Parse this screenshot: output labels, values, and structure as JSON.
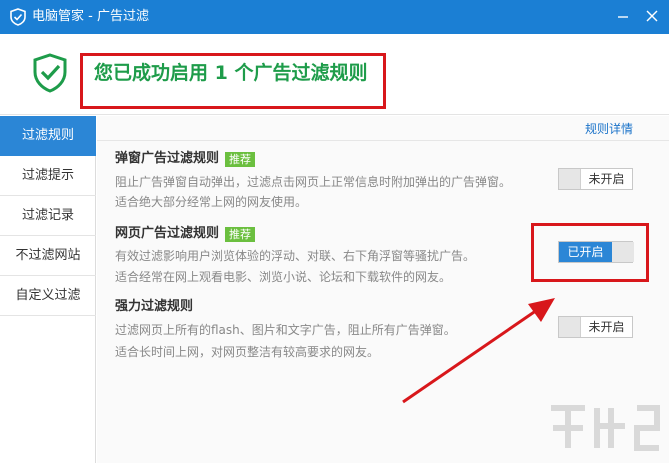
{
  "window": {
    "title": "电脑管家 - 广告过滤"
  },
  "banner": {
    "message": "您已成功启用 1 个广告过滤规则"
  },
  "sidebar": {
    "items": [
      {
        "label": "过滤规则",
        "active": true
      },
      {
        "label": "过滤提示"
      },
      {
        "label": "过滤记录"
      },
      {
        "label": "不过滤网站"
      },
      {
        "label": "自定义过滤"
      }
    ]
  },
  "content": {
    "detail_link": "规则详情",
    "rules": [
      {
        "title": "弹窗广告过滤规则",
        "badge": "推荐",
        "desc1": "阻止广告弹窗自动弹出，过滤点击网页上正常信息时附加弹出的广告弹窗。",
        "desc2": "适合绝大部分经常上网的网友使用。",
        "toggle": "未开启",
        "enabled": false
      },
      {
        "title": "网页广告过滤规则",
        "badge": "推荐",
        "desc1": "有效过滤影响用户浏览体验的浮动、对联、右下角浮窗等骚扰广告。",
        "desc2": "适合经常在网上观看电影、浏览小说、论坛和下载软件的网友。",
        "toggle": "已开启",
        "enabled": true
      },
      {
        "title": "强力过滤规则",
        "desc1": "过滤网页上所有的flash、图片和文字广告，阻止所有广告弹窗。",
        "desc2": "适合长时间上网，对网页整洁有较高要求的网友。",
        "toggle": "未开启",
        "enabled": false
      }
    ]
  },
  "colors": {
    "titlebar": "#1b7fd4",
    "active_nav": "#2b86d6",
    "success_text": "#1e9c4a",
    "badge": "#6bbf3f",
    "annotation_red": "#d8171b"
  }
}
